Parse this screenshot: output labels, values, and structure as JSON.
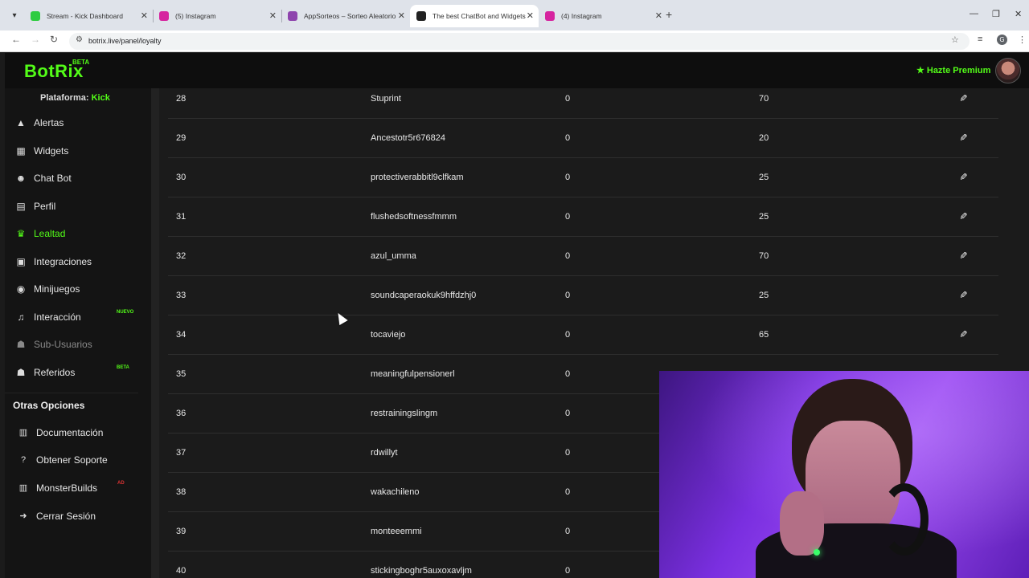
{
  "browser": {
    "tabs": [
      {
        "title": "Stream - Kick Dashboard",
        "favicon_color": "#2ecc40"
      },
      {
        "title": "(5) Instagram",
        "favicon_color": "#d6249f"
      },
      {
        "title": "AppSorteos – Sorteo Aleatorio",
        "favicon_color": "#8e44ad"
      },
      {
        "title": "The best ChatBot and Widgets",
        "favicon_color": "#222222"
      },
      {
        "title": "(4) Instagram",
        "favicon_color": "#d6249f"
      }
    ],
    "active_tab_index": 3,
    "url": "botrix.live/panel/loyalty",
    "profile_initial": "G"
  },
  "header": {
    "logo": "BotRix",
    "logo_badge": "BETA",
    "premium_label": "Hazte Premium"
  },
  "sidebar": {
    "platform_label": "Plataforma:",
    "platform_value": "Kick",
    "items": [
      {
        "label": "Alertas",
        "icon": "warning-icon",
        "glyph": "▲"
      },
      {
        "label": "Widgets",
        "icon": "grid-icon",
        "glyph": "▦"
      },
      {
        "label": "Chat Bot",
        "icon": "robot-icon",
        "glyph": "☻"
      },
      {
        "label": "Perfil",
        "icon": "id-card-icon",
        "glyph": "▤"
      },
      {
        "label": "Lealtad",
        "icon": "trophy-icon",
        "glyph": "♛",
        "active": true
      },
      {
        "label": "Integraciones",
        "icon": "list-icon",
        "glyph": "▣"
      },
      {
        "label": "Minijuegos",
        "icon": "gamepad-icon",
        "glyph": "◉"
      },
      {
        "label": "Interacción",
        "icon": "music-icon",
        "glyph": "♫",
        "badge": "NUEVO"
      },
      {
        "label": "Sub-Usuarios",
        "icon": "users-icon",
        "glyph": "☗",
        "disabled": true
      },
      {
        "label": "Referidos",
        "icon": "user-group-icon",
        "glyph": "☗",
        "badge": "BETA"
      }
    ],
    "other_title": "Otras Opciones",
    "other_items": [
      {
        "label": "Documentación",
        "icon": "document-icon",
        "glyph": "▥"
      },
      {
        "label": "Obtener Soporte",
        "icon": "help-icon",
        "glyph": "?"
      },
      {
        "label": "MonsterBuilds",
        "icon": "build-icon",
        "glyph": "▥",
        "badge": "AD"
      },
      {
        "label": "Cerrar Sesión",
        "icon": "logout-icon",
        "glyph": "➜"
      }
    ]
  },
  "table": {
    "rows": [
      {
        "num": "28",
        "user": "Stuprint",
        "a": "0",
        "b": "70"
      },
      {
        "num": "29",
        "user": "Ancestotr5r676824",
        "a": "0",
        "b": "20"
      },
      {
        "num": "30",
        "user": "protectiverabbitl9clfkam",
        "a": "0",
        "b": "25"
      },
      {
        "num": "31",
        "user": "flushedsoftnessfmmm",
        "a": "0",
        "b": "25"
      },
      {
        "num": "32",
        "user": "azul_umma",
        "a": "0",
        "b": "70"
      },
      {
        "num": "33",
        "user": "soundcaperaokuk9hffdzhj0",
        "a": "0",
        "b": "25"
      },
      {
        "num": "34",
        "user": "tocaviejo",
        "a": "0",
        "b": "65"
      },
      {
        "num": "35",
        "user": "meaningfulpensionerl",
        "a": "0",
        "b": ""
      },
      {
        "num": "36",
        "user": "restrainingslingm",
        "a": "0",
        "b": ""
      },
      {
        "num": "37",
        "user": "rdwillyt",
        "a": "0",
        "b": ""
      },
      {
        "num": "38",
        "user": "wakachileno",
        "a": "0",
        "b": ""
      },
      {
        "num": "39",
        "user": "monteeemmi",
        "a": "0",
        "b": ""
      },
      {
        "num": "40",
        "user": "stickingboghr5auxoxavljm",
        "a": "0",
        "b": ""
      }
    ]
  },
  "colors": {
    "accent": "#53fc18",
    "background": "#1b1b1b",
    "sidebar": "#141414",
    "header": "#0e0e0e"
  }
}
